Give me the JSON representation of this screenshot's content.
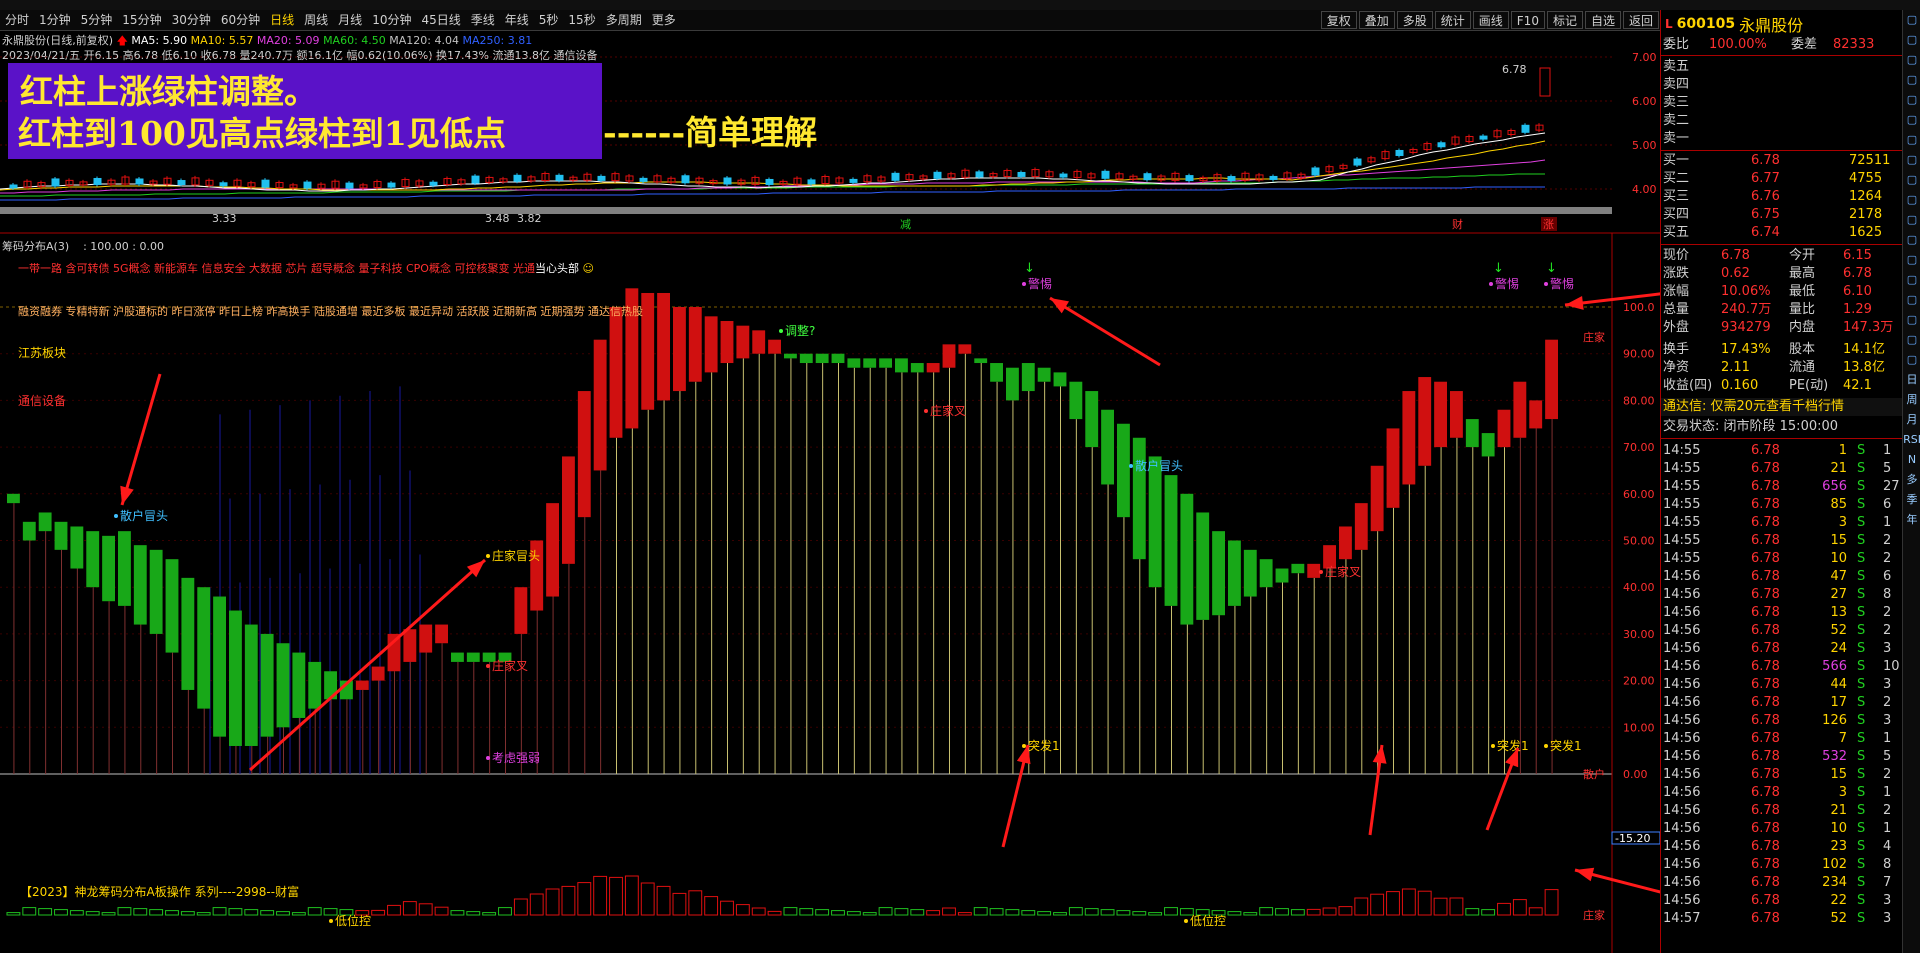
{
  "period_bar": {
    "items": [
      "分时",
      "1分钟",
      "5分钟",
      "15分钟",
      "30分钟",
      "60分钟",
      "日线",
      "周线",
      "月线",
      "10分钟",
      "45日线",
      "季线",
      "年线",
      "5秒",
      "15秒",
      "多周期",
      "更多"
    ],
    "active": "日线"
  },
  "right_buttons": [
    "复权",
    "叠加",
    "多股",
    "统计",
    "画线",
    "F10",
    "标记",
    "自选",
    "返回"
  ],
  "kline_info": {
    "line1_name": "永鼎股份(日线,前复权)",
    "ma5": "MA5: 5.90",
    "ma10": "MA10: 5.57",
    "ma20": "MA20: 5.09",
    "ma60": "MA60: 4.50",
    "ma120": "MA120: 4.04",
    "ma250": "MA250: 3.81",
    "line2": "2023/04/21/五 开6.15 高6.78 低6.10 收6.78 量240.7万 额16.1亿 幅0.62(10.06%) 换17.43% 流通13.8亿 通信设备"
  },
  "banner": {
    "line1": "红柱上涨绿柱调整。",
    "line2": "红柱到100见高点绿柱到1见低点",
    "line2_tail": "------简单理解"
  },
  "kline_axis": [
    "7.00",
    "6.00",
    "5.00",
    "4.00"
  ],
  "kline_marks": {
    "high_label": "6.78",
    "low_label": "3.33",
    "low2": "3.48",
    "low3": "3.82",
    "tag_jian": "减",
    "tag_cai": "财",
    "tag_zhang": "涨"
  },
  "indicator": {
    "title": "筹码分布A(3)",
    "params": ": 100.00 : 0.00",
    "concepts_line1": "一带一路 含可转债 5G概念 新能源车 信息安全 大数据 芯片 超导概念 量子科技 CPO概念 可控核聚变 光通",
    "concepts_line1_tail": "当心头部",
    "concepts_line2": "融资融券 专精特新 沪股通标的 昨日涨停 昨日上榜 昨高换手 陆股通增 最近多板 最近异动 活跃股 近期新高 近期强势 通达信热股",
    "region": "江苏板块",
    "industry": "通信设备",
    "axis": [
      "100.0",
      "90.00",
      "80.00",
      "70.00",
      "60.00",
      "50.00",
      "40.00",
      "30.00",
      "20.00",
      "10.00",
      "0.00"
    ],
    "neg_axis": "-15.20",
    "right_tags": [
      "庄家",
      "散户",
      "庄家"
    ],
    "labels": {
      "sanhu": "散户冒头",
      "zhuang_mt": "庄家冒头",
      "zhuang_cha": "庄家叉",
      "tiaozheng": "调整?",
      "jinjie": "警惕",
      "tufa": "突发1",
      "kaolv": "考虑强弱",
      "diwei": "低位控"
    },
    "footer": "【2023】神龙筹码分布A板操作 系列----2998--财富"
  },
  "chart_data": {
    "type": "bar",
    "title": "筹码分布A(3)",
    "ylim": [
      0,
      100
    ],
    "bars": [
      {
        "o": 60,
        "c": 58,
        "d": "dn"
      },
      {
        "o": 54,
        "c": 50,
        "d": "dn"
      },
      {
        "o": 56,
        "c": 52,
        "d": "dn"
      },
      {
        "o": 54,
        "c": 48,
        "d": "dn"
      },
      {
        "o": 53,
        "c": 44,
        "d": "dn"
      },
      {
        "o": 52,
        "c": 40,
        "d": "dn"
      },
      {
        "o": 51,
        "c": 37,
        "d": "dn"
      },
      {
        "o": 52,
        "c": 36,
        "d": "dn"
      },
      {
        "o": 49,
        "c": 32,
        "d": "dn"
      },
      {
        "o": 48,
        "c": 30,
        "d": "dn"
      },
      {
        "o": 46,
        "c": 26,
        "d": "dn"
      },
      {
        "o": 42,
        "c": 18,
        "d": "dn"
      },
      {
        "o": 40,
        "c": 14,
        "d": "dn"
      },
      {
        "o": 38,
        "c": 8,
        "d": "dn"
      },
      {
        "o": 35,
        "c": 6,
        "d": "dn"
      },
      {
        "o": 32,
        "c": 6,
        "d": "dn"
      },
      {
        "o": 30,
        "c": 8,
        "d": "dn"
      },
      {
        "o": 28,
        "c": 10,
        "d": "dn"
      },
      {
        "o": 26,
        "c": 12,
        "d": "dn"
      },
      {
        "o": 24,
        "c": 14,
        "d": "dn"
      },
      {
        "o": 22,
        "c": 16,
        "d": "dn"
      },
      {
        "o": 20,
        "c": 16,
        "d": "dn"
      },
      {
        "o": 18,
        "c": 20,
        "d": "up"
      },
      {
        "o": 20,
        "c": 23,
        "d": "up"
      },
      {
        "o": 22,
        "c": 30,
        "d": "up"
      },
      {
        "o": 24,
        "c": 31,
        "d": "up"
      },
      {
        "o": 26,
        "c": 32,
        "d": "up"
      },
      {
        "o": 28,
        "c": 32,
        "d": "up"
      },
      {
        "o": 26,
        "c": 24,
        "d": "dn"
      },
      {
        "o": 26,
        "c": 24,
        "d": "dn"
      },
      {
        "o": 26,
        "c": 24,
        "d": "dn"
      },
      {
        "o": 26,
        "c": 24,
        "d": "dn"
      },
      {
        "o": 30,
        "c": 40,
        "d": "up"
      },
      {
        "o": 35,
        "c": 50,
        "d": "up"
      },
      {
        "o": 38,
        "c": 58,
        "d": "up"
      },
      {
        "o": 45,
        "c": 68,
        "d": "up"
      },
      {
        "o": 55,
        "c": 82,
        "d": "up"
      },
      {
        "o": 65,
        "c": 93,
        "d": "up"
      },
      {
        "o": 72,
        "c": 100,
        "d": "up"
      },
      {
        "o": 74,
        "c": 104,
        "d": "up"
      },
      {
        "o": 78,
        "c": 103,
        "d": "up"
      },
      {
        "o": 80,
        "c": 103,
        "d": "up"
      },
      {
        "o": 82,
        "c": 100,
        "d": "up"
      },
      {
        "o": 84,
        "c": 100,
        "d": "up"
      },
      {
        "o": 86,
        "c": 98,
        "d": "up"
      },
      {
        "o": 88,
        "c": 97,
        "d": "up"
      },
      {
        "o": 89,
        "c": 96,
        "d": "up"
      },
      {
        "o": 90,
        "c": 95,
        "d": "up"
      },
      {
        "o": 90,
        "c": 93,
        "d": "up"
      },
      {
        "o": 90,
        "c": 89,
        "d": "dn"
      },
      {
        "o": 90,
        "c": 88,
        "d": "dn"
      },
      {
        "o": 90,
        "c": 88,
        "d": "dn"
      },
      {
        "o": 90,
        "c": 88,
        "d": "dn"
      },
      {
        "o": 89,
        "c": 87,
        "d": "dn"
      },
      {
        "o": 89,
        "c": 87,
        "d": "dn"
      },
      {
        "o": 89,
        "c": 87,
        "d": "dn"
      },
      {
        "o": 89,
        "c": 86,
        "d": "dn"
      },
      {
        "o": 88,
        "c": 86,
        "d": "dn"
      },
      {
        "o": 86,
        "c": 88,
        "d": "up"
      },
      {
        "o": 87,
        "c": 92,
        "d": "up"
      },
      {
        "o": 90,
        "c": 92,
        "d": "up"
      },
      {
        "o": 89,
        "c": 88,
        "d": "dn"
      },
      {
        "o": 88,
        "c": 84,
        "d": "dn"
      },
      {
        "o": 87,
        "c": 80,
        "d": "dn"
      },
      {
        "o": 88,
        "c": 82,
        "d": "dn"
      },
      {
        "o": 87,
        "c": 84,
        "d": "dn"
      },
      {
        "o": 86,
        "c": 83,
        "d": "dn"
      },
      {
        "o": 84,
        "c": 76,
        "d": "dn"
      },
      {
        "o": 82,
        "c": 70,
        "d": "dn"
      },
      {
        "o": 78,
        "c": 62,
        "d": "dn"
      },
      {
        "o": 75,
        "c": 55,
        "d": "dn"
      },
      {
        "o": 72,
        "c": 46,
        "d": "dn"
      },
      {
        "o": 68,
        "c": 40,
        "d": "dn"
      },
      {
        "o": 64,
        "c": 36,
        "d": "dn"
      },
      {
        "o": 60,
        "c": 32,
        "d": "dn"
      },
      {
        "o": 56,
        "c": 33,
        "d": "dn"
      },
      {
        "o": 52,
        "c": 34,
        "d": "dn"
      },
      {
        "o": 50,
        "c": 36,
        "d": "dn"
      },
      {
        "o": 48,
        "c": 38,
        "d": "dn"
      },
      {
        "o": 46,
        "c": 40,
        "d": "dn"
      },
      {
        "o": 44,
        "c": 41,
        "d": "dn"
      },
      {
        "o": 45,
        "c": 43,
        "d": "dn"
      },
      {
        "o": 42,
        "c": 45,
        "d": "up"
      },
      {
        "o": 44,
        "c": 49,
        "d": "up"
      },
      {
        "o": 46,
        "c": 53,
        "d": "up"
      },
      {
        "o": 48,
        "c": 58,
        "d": "up"
      },
      {
        "o": 52,
        "c": 66,
        "d": "up"
      },
      {
        "o": 57,
        "c": 74,
        "d": "up"
      },
      {
        "o": 62,
        "c": 82,
        "d": "up"
      },
      {
        "o": 66,
        "c": 85,
        "d": "up"
      },
      {
        "o": 70,
        "c": 84,
        "d": "up"
      },
      {
        "o": 72,
        "c": 82,
        "d": "up"
      },
      {
        "o": 70,
        "c": 76,
        "d": "dn"
      },
      {
        "o": 68,
        "c": 73,
        "d": "dn"
      },
      {
        "o": 70,
        "c": 78,
        "d": "up"
      },
      {
        "o": 72,
        "c": 84,
        "d": "up"
      },
      {
        "o": 74,
        "c": 80,
        "d": "up"
      },
      {
        "o": 76,
        "c": 93,
        "d": "up"
      }
    ]
  },
  "quote": {
    "code": "600105",
    "name": "永鼎股份",
    "weibi_label": "委比",
    "weibi": "100.00%",
    "weicha_label": "委差",
    "weicha": "82333",
    "sells": [
      "卖五",
      "卖四",
      "卖三",
      "卖二",
      "卖一"
    ],
    "buys": [
      [
        "买一",
        "6.78",
        "72511"
      ],
      [
        "买二",
        "6.77",
        "4755"
      ],
      [
        "买三",
        "6.76",
        "1264"
      ],
      [
        "买四",
        "6.75",
        "2178"
      ],
      [
        "买五",
        "6.74",
        "1625"
      ]
    ],
    "stats": [
      [
        "现价",
        "6.78",
        "今开",
        "6.15"
      ],
      [
        "涨跌",
        "0.62",
        "最高",
        "6.78"
      ],
      [
        "涨幅",
        "10.06%",
        "最低",
        "6.10"
      ],
      [
        "总量",
        "240.7万",
        "量比",
        "1.29"
      ],
      [
        "外盘",
        "934279",
        "内盘",
        "147.3万"
      ],
      [
        "换手",
        "17.43%",
        "股本",
        "14.1亿"
      ],
      [
        "净资",
        "2.11",
        "流通",
        "13.8亿"
      ],
      [
        "收益(四)",
        "0.160",
        "PE(动)",
        "42.1"
      ]
    ],
    "ad": "通达信: 仅需20元查看千档行情",
    "status": "交易状态: 闭市阶段 15:00:00",
    "ticks": [
      [
        "14:55",
        "6.78",
        "1",
        "S",
        "1"
      ],
      [
        "14:55",
        "6.78",
        "21",
        "S",
        "5"
      ],
      [
        "14:55",
        "6.78",
        "656",
        "S",
        "27"
      ],
      [
        "14:55",
        "6.78",
        "85",
        "S",
        "6"
      ],
      [
        "14:55",
        "6.78",
        "3",
        "S",
        "1"
      ],
      [
        "14:55",
        "6.78",
        "15",
        "S",
        "2"
      ],
      [
        "14:55",
        "6.78",
        "10",
        "S",
        "2"
      ],
      [
        "14:56",
        "6.78",
        "47",
        "S",
        "6"
      ],
      [
        "14:56",
        "6.78",
        "27",
        "S",
        "8"
      ],
      [
        "14:56",
        "6.78",
        "13",
        "S",
        "2"
      ],
      [
        "14:56",
        "6.78",
        "52",
        "S",
        "2"
      ],
      [
        "14:56",
        "6.78",
        "24",
        "S",
        "3"
      ],
      [
        "14:56",
        "6.78",
        "566",
        "S",
        "10"
      ],
      [
        "14:56",
        "6.78",
        "44",
        "S",
        "3"
      ],
      [
        "14:56",
        "6.78",
        "17",
        "S",
        "2"
      ],
      [
        "14:56",
        "6.78",
        "126",
        "S",
        "3"
      ],
      [
        "14:56",
        "6.78",
        "7",
        "S",
        "1"
      ],
      [
        "14:56",
        "6.78",
        "532",
        "S",
        "5"
      ],
      [
        "14:56",
        "6.78",
        "15",
        "S",
        "2"
      ],
      [
        "14:56",
        "6.78",
        "3",
        "S",
        "1"
      ],
      [
        "14:56",
        "6.78",
        "21",
        "S",
        "2"
      ],
      [
        "14:56",
        "6.78",
        "10",
        "S",
        "1"
      ],
      [
        "14:56",
        "6.78",
        "23",
        "S",
        "4"
      ],
      [
        "14:56",
        "6.78",
        "102",
        "S",
        "8"
      ],
      [
        "14:56",
        "6.78",
        "234",
        "S",
        "7"
      ],
      [
        "14:56",
        "6.78",
        "22",
        "S",
        "3"
      ],
      [
        "14:57",
        "6.78",
        "52",
        "S",
        "3"
      ]
    ]
  },
  "side_tools": [
    "日",
    "周",
    "月",
    "RSI",
    "N",
    "多",
    "季",
    "年"
  ],
  "colors": {
    "up": "#e01010",
    "down": "#10b010",
    "accent": "#ffd400",
    "banner": "#5a12c8"
  }
}
